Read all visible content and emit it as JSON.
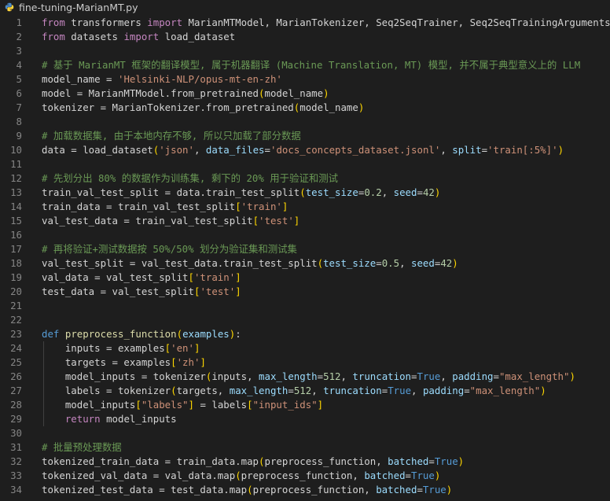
{
  "tab": {
    "filename": "fine-tuning-MarianMT.py",
    "icon": "python-file-icon"
  },
  "colors": {
    "background": "#1e1e1e",
    "keyword": "#c586c0",
    "def": "#569cd6",
    "function": "#dcdcaa",
    "variable": "#9cdcfe",
    "string": "#ce9178",
    "number": "#b5cea8",
    "comment": "#6a9955",
    "bracket1": "#ffd700",
    "bracket2": "#da70d6"
  },
  "lines": [
    {
      "n": "1",
      "tokens": [
        [
          "kw",
          "from"
        ],
        [
          "p",
          " transformers "
        ],
        [
          "kw",
          "import"
        ],
        [
          "p",
          " MarianMTModel, MarianTokenizer, Seq2SeqTrainer, Seq2SeqTrainingArguments"
        ]
      ]
    },
    {
      "n": "2",
      "tokens": [
        [
          "kw",
          "from"
        ],
        [
          "p",
          " datasets "
        ],
        [
          "kw",
          "import"
        ],
        [
          "p",
          " load_dataset"
        ]
      ]
    },
    {
      "n": "3",
      "tokens": []
    },
    {
      "n": "4",
      "tokens": [
        [
          "com",
          "# 基于 MarianMT 框架的翻译模型, 属于机器翻译 (Machine Translation, MT) 模型, 并不属于典型意义上的 LLM"
        ]
      ]
    },
    {
      "n": "5",
      "tokens": [
        [
          "p",
          "model_name = "
        ],
        [
          "str",
          "'Helsinki-NLP/opus-mt-en-zh'"
        ]
      ]
    },
    {
      "n": "6",
      "tokens": [
        [
          "p",
          "model = MarianMTModel.from_pretrained"
        ],
        [
          "br",
          "("
        ],
        [
          "p",
          "model_name"
        ],
        [
          "br",
          ")"
        ]
      ]
    },
    {
      "n": "7",
      "tokens": [
        [
          "p",
          "tokenizer = MarianTokenizer.from_pretrained"
        ],
        [
          "br",
          "("
        ],
        [
          "p",
          "model_name"
        ],
        [
          "br",
          ")"
        ]
      ]
    },
    {
      "n": "8",
      "tokens": []
    },
    {
      "n": "9",
      "tokens": [
        [
          "com",
          "# 加载数据集, 由于本地内存不够, 所以只加载了部分数据"
        ]
      ]
    },
    {
      "n": "10",
      "tokens": [
        [
          "p",
          "data = load_dataset"
        ],
        [
          "br",
          "("
        ],
        [
          "str",
          "'json'"
        ],
        [
          "p",
          ", "
        ],
        [
          "var",
          "data_files"
        ],
        [
          "p",
          "="
        ],
        [
          "str",
          "'docs_concepts_dataset.jsonl'"
        ],
        [
          "p",
          ", "
        ],
        [
          "var",
          "split"
        ],
        [
          "p",
          "="
        ],
        [
          "str",
          "'train[:5%]'"
        ],
        [
          "br",
          ")"
        ]
      ]
    },
    {
      "n": "11",
      "tokens": []
    },
    {
      "n": "12",
      "tokens": [
        [
          "com",
          "# 先划分出 80% 的数据作为训练集, 剩下的 20% 用于验证和测试"
        ]
      ]
    },
    {
      "n": "13",
      "tokens": [
        [
          "p",
          "train_val_test_split = data.train_test_split"
        ],
        [
          "br",
          "("
        ],
        [
          "var",
          "test_size"
        ],
        [
          "p",
          "="
        ],
        [
          "num",
          "0.2"
        ],
        [
          "p",
          ", "
        ],
        [
          "var",
          "seed"
        ],
        [
          "p",
          "="
        ],
        [
          "num",
          "42"
        ],
        [
          "br",
          ")"
        ]
      ]
    },
    {
      "n": "14",
      "tokens": [
        [
          "p",
          "train_data = train_val_test_split"
        ],
        [
          "br",
          "["
        ],
        [
          "str",
          "'train'"
        ],
        [
          "br",
          "]"
        ]
      ]
    },
    {
      "n": "15",
      "tokens": [
        [
          "p",
          "val_test_data = train_val_test_split"
        ],
        [
          "br",
          "["
        ],
        [
          "str",
          "'test'"
        ],
        [
          "br",
          "]"
        ]
      ]
    },
    {
      "n": "16",
      "tokens": []
    },
    {
      "n": "17",
      "tokens": [
        [
          "com",
          "# 再将验证+测试数据按 50%/50% 划分为验证集和测试集"
        ]
      ]
    },
    {
      "n": "18",
      "tokens": [
        [
          "p",
          "val_test_split = val_test_data.train_test_split"
        ],
        [
          "br",
          "("
        ],
        [
          "var",
          "test_size"
        ],
        [
          "p",
          "="
        ],
        [
          "num",
          "0.5"
        ],
        [
          "p",
          ", "
        ],
        [
          "var",
          "seed"
        ],
        [
          "p",
          "="
        ],
        [
          "num",
          "42"
        ],
        [
          "br",
          ")"
        ]
      ]
    },
    {
      "n": "19",
      "tokens": [
        [
          "p",
          "val_data = val_test_split"
        ],
        [
          "br",
          "["
        ],
        [
          "str",
          "'train'"
        ],
        [
          "br",
          "]"
        ]
      ]
    },
    {
      "n": "20",
      "tokens": [
        [
          "p",
          "test_data = val_test_split"
        ],
        [
          "br",
          "["
        ],
        [
          "str",
          "'test'"
        ],
        [
          "br",
          "]"
        ]
      ]
    },
    {
      "n": "21",
      "tokens": []
    },
    {
      "n": "22",
      "tokens": []
    },
    {
      "n": "23",
      "tokens": [
        [
          "def",
          "def"
        ],
        [
          "p",
          " "
        ],
        [
          "fn",
          "preprocess_function"
        ],
        [
          "br",
          "("
        ],
        [
          "var",
          "examples"
        ],
        [
          "br",
          ")"
        ],
        [
          "p",
          ":"
        ]
      ]
    },
    {
      "n": "24",
      "tokens": [
        [
          "p",
          "    inputs = examples"
        ],
        [
          "br",
          "["
        ],
        [
          "str",
          "'en'"
        ],
        [
          "br",
          "]"
        ]
      ]
    },
    {
      "n": "25",
      "tokens": [
        [
          "p",
          "    targets = examples"
        ],
        [
          "br",
          "["
        ],
        [
          "str",
          "'zh'"
        ],
        [
          "br",
          "]"
        ]
      ]
    },
    {
      "n": "26",
      "tokens": [
        [
          "p",
          "    model_inputs = tokenizer"
        ],
        [
          "br",
          "("
        ],
        [
          "p",
          "inputs, "
        ],
        [
          "var",
          "max_length"
        ],
        [
          "p",
          "="
        ],
        [
          "num",
          "512"
        ],
        [
          "p",
          ", "
        ],
        [
          "var",
          "truncation"
        ],
        [
          "p",
          "="
        ],
        [
          "bool",
          "True"
        ],
        [
          "p",
          ", "
        ],
        [
          "var",
          "padding"
        ],
        [
          "p",
          "="
        ],
        [
          "str",
          "\"max_length\""
        ],
        [
          "br",
          ")"
        ]
      ]
    },
    {
      "n": "27",
      "tokens": [
        [
          "p",
          "    labels = tokenizer"
        ],
        [
          "br",
          "("
        ],
        [
          "p",
          "targets, "
        ],
        [
          "var",
          "max_length"
        ],
        [
          "p",
          "="
        ],
        [
          "num",
          "512"
        ],
        [
          "p",
          ", "
        ],
        [
          "var",
          "truncation"
        ],
        [
          "p",
          "="
        ],
        [
          "bool",
          "True"
        ],
        [
          "p",
          ", "
        ],
        [
          "var",
          "padding"
        ],
        [
          "p",
          "="
        ],
        [
          "str",
          "\"max_length\""
        ],
        [
          "br",
          ")"
        ]
      ]
    },
    {
      "n": "28",
      "tokens": [
        [
          "p",
          "    model_inputs"
        ],
        [
          "br",
          "["
        ],
        [
          "str",
          "\"labels\""
        ],
        [
          "br",
          "]"
        ],
        [
          "p",
          " = labels"
        ],
        [
          "br",
          "["
        ],
        [
          "str",
          "\"input_ids\""
        ],
        [
          "br",
          "]"
        ]
      ]
    },
    {
      "n": "29",
      "tokens": [
        [
          "p",
          "    "
        ],
        [
          "kw",
          "return"
        ],
        [
          "p",
          " model_inputs"
        ]
      ]
    },
    {
      "n": "30",
      "tokens": []
    },
    {
      "n": "31",
      "tokens": [
        [
          "com",
          "# 批量预处理数据"
        ]
      ]
    },
    {
      "n": "32",
      "tokens": [
        [
          "p",
          "tokenized_train_data = train_data.map"
        ],
        [
          "br",
          "("
        ],
        [
          "p",
          "preprocess_function, "
        ],
        [
          "var",
          "batched"
        ],
        [
          "p",
          "="
        ],
        [
          "bool",
          "True"
        ],
        [
          "br",
          ")"
        ]
      ]
    },
    {
      "n": "33",
      "tokens": [
        [
          "p",
          "tokenized_val_data = val_data.map"
        ],
        [
          "br",
          "("
        ],
        [
          "p",
          "preprocess_function, "
        ],
        [
          "var",
          "batched"
        ],
        [
          "p",
          "="
        ],
        [
          "bool",
          "True"
        ],
        [
          "br",
          ")"
        ]
      ]
    },
    {
      "n": "34",
      "tokens": [
        [
          "p",
          "tokenized_test_data = test_data.map"
        ],
        [
          "br",
          "("
        ],
        [
          "p",
          "preprocess_function, "
        ],
        [
          "var",
          "batched"
        ],
        [
          "p",
          "="
        ],
        [
          "bool",
          "True"
        ],
        [
          "br",
          ")"
        ]
      ]
    }
  ]
}
